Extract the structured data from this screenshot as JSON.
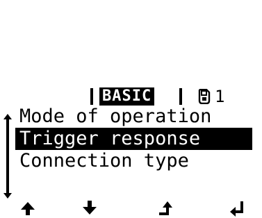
{
  "header": {
    "mode_label": "BASIC",
    "page_number": "1",
    "page_icon": "memory-card-icon"
  },
  "menu": {
    "items": [
      {
        "label": "Mode of operation",
        "selected": false
      },
      {
        "label": "Trigger response",
        "selected": true
      },
      {
        "label": "Connection type",
        "selected": false
      }
    ]
  },
  "footer": {
    "buttons": [
      {
        "icon": "arrow-up-icon"
      },
      {
        "icon": "arrow-down-icon"
      },
      {
        "icon": "return-up-icon"
      },
      {
        "icon": "enter-icon"
      }
    ]
  },
  "colors": {
    "background": "#ffffff",
    "foreground": "#000000"
  }
}
